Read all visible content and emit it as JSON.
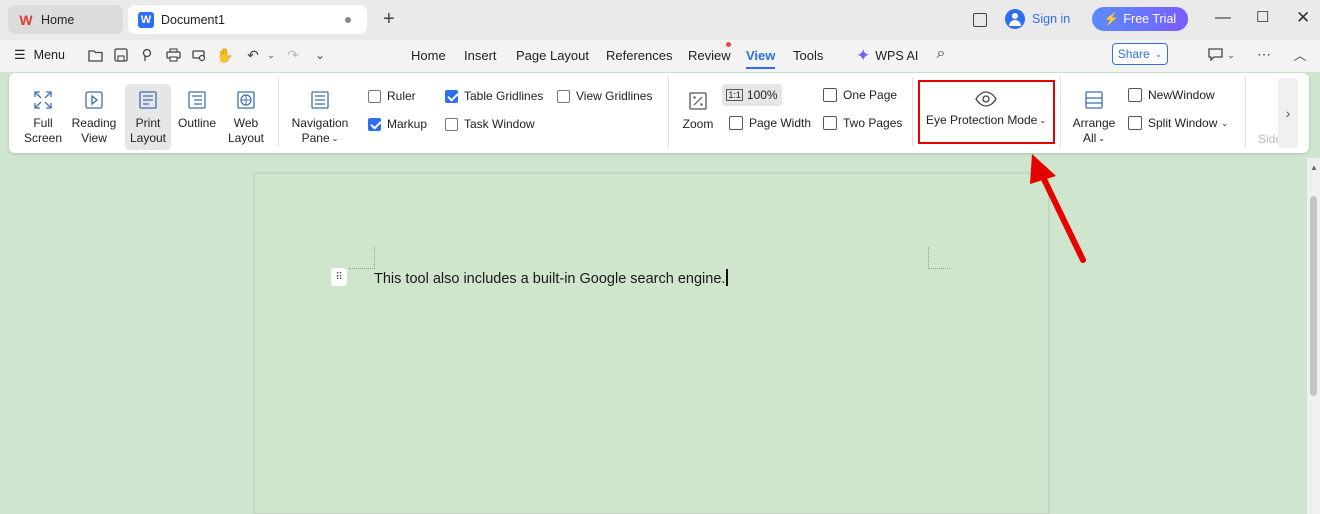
{
  "tabs": {
    "home_label": "Home",
    "doc_label": "Document1"
  },
  "header": {
    "sign_in": "Sign in",
    "free_trial": "Free Trial"
  },
  "menubar": {
    "menu_label": "Menu",
    "tabs": [
      "Home",
      "Insert",
      "Page Layout",
      "References",
      "Review",
      "View",
      "Tools"
    ],
    "active_tab": "View",
    "wps_ai": "WPS AI",
    "share": "Share"
  },
  "ribbon": {
    "full_screen": [
      "Full",
      "Screen"
    ],
    "reading_view": [
      "Reading",
      "View"
    ],
    "print_layout": [
      "Print",
      "Layout"
    ],
    "outline": "Outline",
    "web_layout": [
      "Web",
      "Layout"
    ],
    "navigation_pane": [
      "Navigation",
      "Pane"
    ],
    "ruler": "Ruler",
    "markup": "Markup",
    "table_gridlines": "Table Gridlines",
    "task_window": "Task Window",
    "view_gridlines": "View Gridlines",
    "zoom": "Zoom",
    "zoom_100": "100%",
    "page_width": "Page Width",
    "one_page": "One Page",
    "two_pages": "Two Pages",
    "eye_protection": "Eye Protection Mode",
    "arrange_all": [
      "Arrange",
      "All"
    ],
    "new_window": "NewWindow",
    "split_window": "Split Window",
    "side": "Side",
    "checked": {
      "ruler": false,
      "markup": true,
      "table_gridlines": true,
      "task_window": false,
      "view_gridlines": false
    }
  },
  "document": {
    "text": "This tool also includes a built-in Google search engine."
  },
  "colors": {
    "accent": "#2d6ff0",
    "highlight": "#e60000",
    "page_bg": "#cfe6cc"
  }
}
